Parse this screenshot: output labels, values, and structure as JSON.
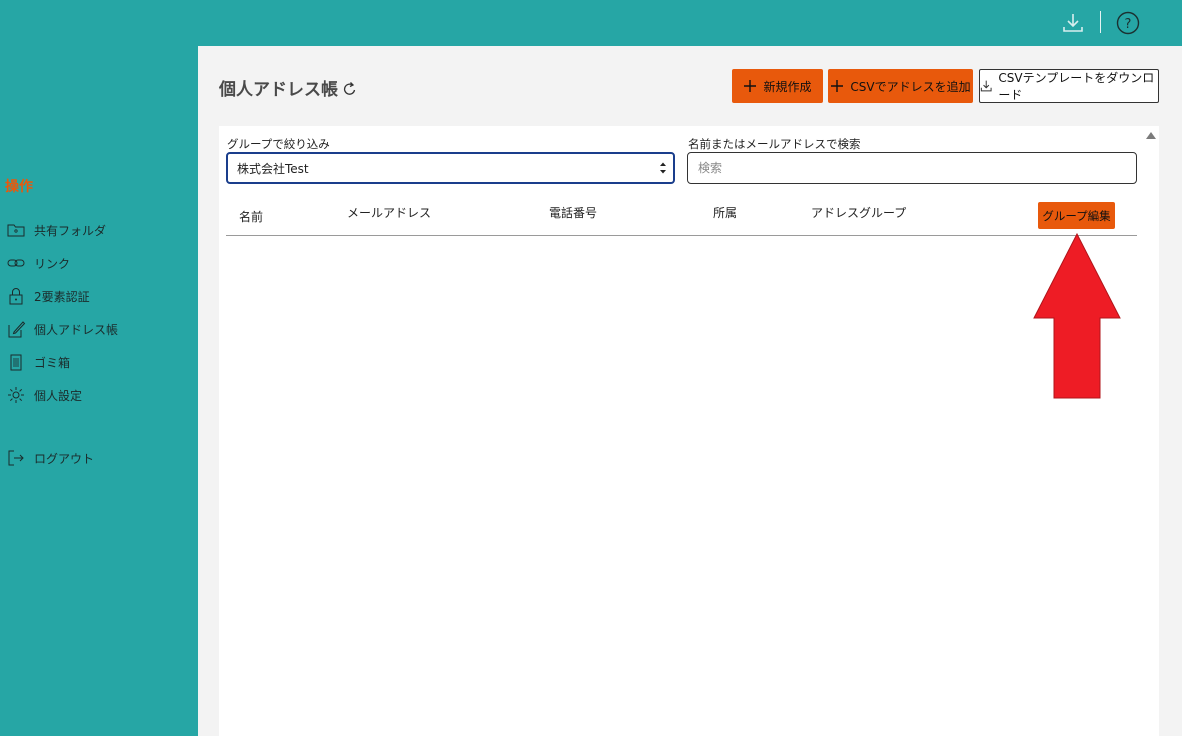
{
  "header": {
    "download_icon": "download-icon",
    "help_icon": "help-circle-icon"
  },
  "sidebar": {
    "section_title": "操作",
    "items": [
      {
        "label": "共有フォルダ",
        "icon": "folder-icon"
      },
      {
        "label": "リンク",
        "icon": "link-icon"
      },
      {
        "label": "2要素認証",
        "icon": "lock-icon"
      },
      {
        "label": "個人アドレス帳",
        "icon": "edit-icon"
      },
      {
        "label": "ゴミ箱",
        "icon": "trash-icon"
      },
      {
        "label": "個人設定",
        "icon": "gear-icon"
      }
    ],
    "logout_label": "ログアウト",
    "logout_icon": "logout-icon"
  },
  "main": {
    "title": "個人アドレス帳",
    "refresh_icon": "refresh-icon",
    "buttons": {
      "new_label": "新規作成",
      "csv_add_label": "CSVでアドレスを追加",
      "csv_template_label": "CSVテンプレートをダウンロード"
    },
    "filter": {
      "group_label": "グループで絞り込み",
      "group_value": "株式会社Test",
      "search_label": "名前またはメールアドレスで検索",
      "search_placeholder": "検索",
      "search_value": ""
    },
    "table": {
      "columns": [
        "名前",
        "メールアドレス",
        "電話番号",
        "所属",
        "アドレスグループ"
      ],
      "group_edit_label": "グループ編集",
      "rows": []
    }
  },
  "colors": {
    "teal": "#26a6a5",
    "accent": "#e8590c",
    "annotation_arrow": "#ee1c25"
  }
}
